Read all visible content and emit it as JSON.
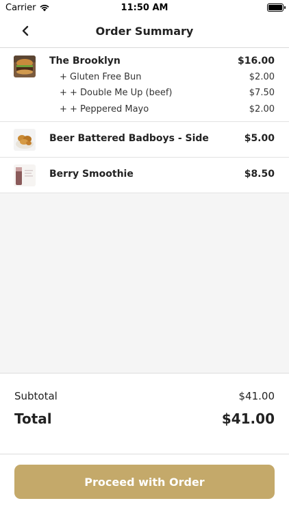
{
  "status_bar": {
    "carrier": "Carrier",
    "time": "11:50 AM"
  },
  "nav": {
    "title": "Order Summary",
    "back_icon": "chevron-left-icon"
  },
  "order_items": [
    {
      "name": "The Brooklyn",
      "price": "$16.00",
      "thumb_icon": "burger-image",
      "modifiers": [
        {
          "name": "+ Gluten Free Bun",
          "price": "$2.00"
        },
        {
          "name": "+ + Double Me Up (beef)",
          "price": "$7.50"
        },
        {
          "name": "+ + Peppered Mayo",
          "price": "$2.00"
        }
      ]
    },
    {
      "name": "Beer Battered Badboys - Side",
      "price": "$5.00",
      "thumb_icon": "fries-image",
      "modifiers": []
    },
    {
      "name": "Berry Smoothie",
      "price": "$8.50",
      "thumb_icon": "smoothie-image",
      "modifiers": []
    }
  ],
  "totals": {
    "subtotal_label": "Subtotal",
    "subtotal_value": "$41.00",
    "total_label": "Total",
    "total_value": "$41.00"
  },
  "proceed_button": {
    "label": "Proceed with Order"
  },
  "colors": {
    "accent": "#c4a96a",
    "divider": "#e2e2e2",
    "empty_bg": "#f5f5f5"
  }
}
